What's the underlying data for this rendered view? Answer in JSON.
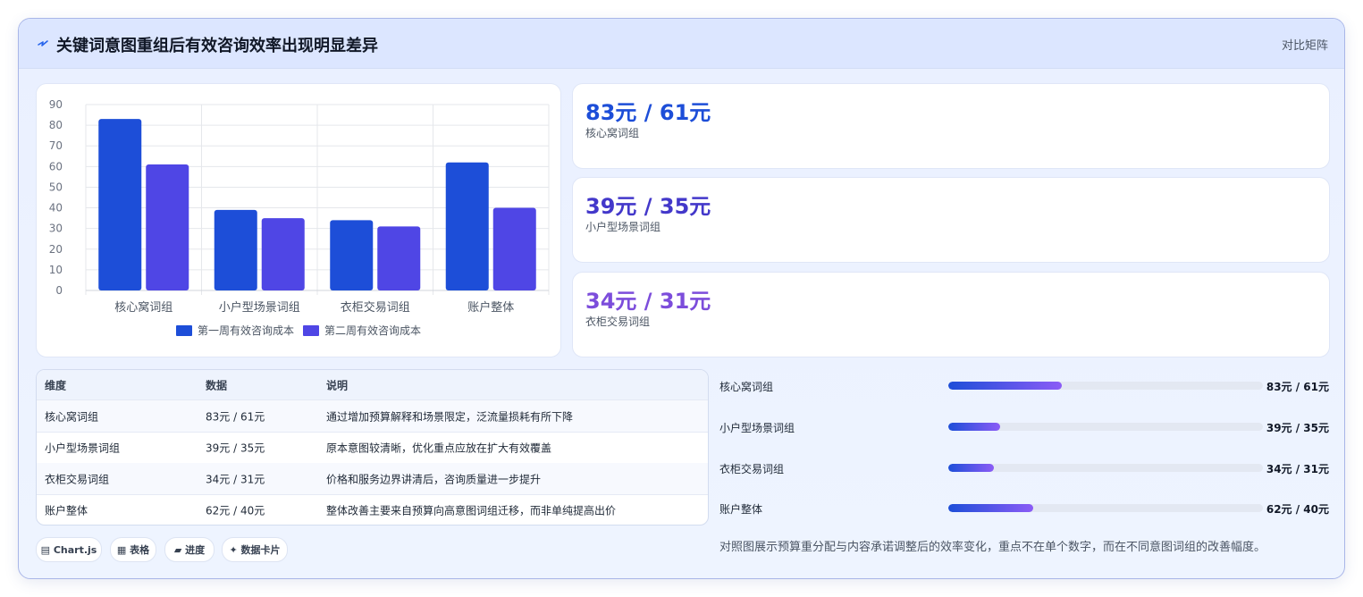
{
  "header": {
    "title": "关键词意图重组后有效咨询效率出现明显差异",
    "tag": "对比矩阵",
    "icon": "sparkle-icon",
    "accent": "#2563eb"
  },
  "chart_data": {
    "type": "bar",
    "categories": [
      "核心窝词组",
      "小户型场景词组",
      "衣柜交易词组",
      "账户整体"
    ],
    "series": [
      {
        "name": "第一周有效咨询成本",
        "values": [
          83,
          39,
          34,
          62
        ],
        "color": "#1d4ed8"
      },
      {
        "name": "第二周有效咨询成本",
        "values": [
          61,
          35,
          31,
          40
        ],
        "color": "#4f46e5"
      }
    ],
    "yticks": [
      "0",
      "10",
      "20",
      "30",
      "40",
      "50",
      "60",
      "70",
      "80",
      "90"
    ],
    "ylim": [
      0,
      90
    ],
    "grid": true,
    "legend": "bottom"
  },
  "kpis": [
    {
      "value": "83元 / 61元",
      "label": "核心窝词组",
      "color": "#1d4ed8"
    },
    {
      "value": "39元 / 35元",
      "label": "小户型场景词组",
      "color": "#4338ca"
    },
    {
      "value": "34元 / 31元",
      "label": "衣柜交易词组",
      "color": "#7c4ddb"
    }
  ],
  "table": {
    "headers": [
      "维度",
      "数据",
      "说明"
    ],
    "rows": [
      [
        "核心窝词组",
        "83元 / 61元",
        "通过增加预算解释和场景限定，泛流量损耗有所下降"
      ],
      [
        "小户型场景词组",
        "39元 / 35元",
        "原本意图较清晰，优化重点应放在扩大有效覆盖"
      ],
      [
        "衣柜交易词组",
        "34元 / 31元",
        "价格和服务边界讲清后，咨询质量进一步提升"
      ],
      [
        "账户整体",
        "62元 / 40元",
        "整体改善主要来自预算向高意图词组迁移，而非单纯提高出价"
      ]
    ]
  },
  "chips": [
    {
      "label": "▤ Chart.js",
      "icon": "chart-icon"
    },
    {
      "label": "▦ 表格",
      "icon": "table-icon"
    },
    {
      "label": "▰ 进度",
      "icon": "progress-icon"
    },
    {
      "label": "✦ 数据卡片",
      "icon": "card-icon"
    }
  ],
  "progress": [
    {
      "name": "核心窝词组",
      "value": "83元 / 61元",
      "fraction": 0.36
    },
    {
      "name": "小户型场景词组",
      "value": "39元 / 35元",
      "fraction": 0.165
    },
    {
      "name": "衣柜交易词组",
      "value": "34元 / 31元",
      "fraction": 0.145
    },
    {
      "name": "账户整体",
      "value": "62元 / 40元",
      "fraction": 0.27
    }
  ],
  "note": "对照图展示预算重分配与内容承诺调整后的效率变化，重点不在单个数字，而在不同意图词组的改善幅度。"
}
